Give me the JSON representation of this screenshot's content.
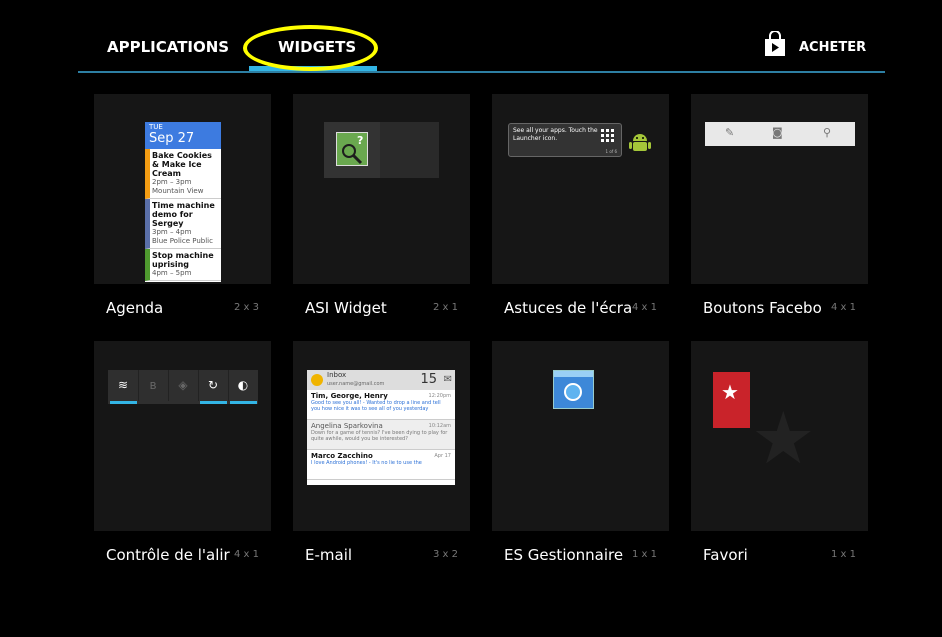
{
  "tabs": {
    "applications": "APPLICATIONS",
    "widgets": "WIDGETS",
    "store": "ACHETER"
  },
  "colors": {
    "accent": "#33b5e5",
    "highlight": "#ffff00"
  },
  "widgets": [
    {
      "label": "Agenda",
      "size": "2 x 3"
    },
    {
      "label": "ASI Widget",
      "size": "2 x 1"
    },
    {
      "label": "Astuces de l'écra",
      "size": "4 x 1"
    },
    {
      "label": "Boutons Facebo",
      "size": "4 x 1"
    },
    {
      "label": "Contrôle de l'alir",
      "size": "4 x 1"
    },
    {
      "label": "E-mail",
      "size": "3 x 2"
    },
    {
      "label": "ES Gestionnaire",
      "size": "1 x 1"
    },
    {
      "label": "Favori",
      "size": "1 x 1"
    }
  ],
  "agenda_preview": {
    "day": "TUE",
    "date": "Sep 27",
    "events": [
      {
        "title": "Bake Cookies & Make Ice Cream",
        "time": "2pm – 3pm",
        "place": "Mountain View"
      },
      {
        "title": "Time machine demo for Sergey",
        "time": "3pm – 4pm",
        "place": "Blue Police Public"
      },
      {
        "title": "Stop machine uprising",
        "time": "4pm – 5pm",
        "place": ""
      }
    ]
  },
  "tips_preview": {
    "text": "See all your apps. Touch the Launcher icon.",
    "page": "1 of 6"
  },
  "email_preview": {
    "folder": "Inbox",
    "account": "user.name@gmail.com",
    "count": "15",
    "messages": [
      {
        "from": "Tim, George, Henry",
        "preview": "Good to see you all! - Wanted to drop a line and tell you how nice it was to see all of you yesterday",
        "time": "12:20pm"
      },
      {
        "from": "Angelina Sparkovina",
        "preview": "Down for a game of tennis? I've been dying to play for quite awhile, would you be interested?",
        "time": "10:12am"
      },
      {
        "from": "Marco Zacchino",
        "preview": "I love Android phones! - It's no lie to use the",
        "time": "Apr 17"
      }
    ]
  }
}
